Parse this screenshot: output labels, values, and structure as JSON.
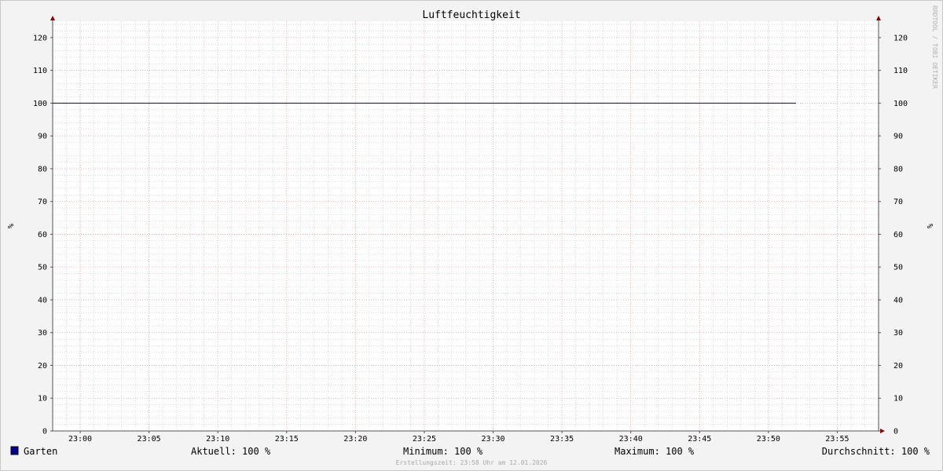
{
  "chart_data": {
    "type": "line",
    "title": "Luftfeuchtigkeit",
    "ylabel": "%",
    "ylabel_right": "%",
    "ylim": [
      0,
      125
    ],
    "y_ticks": [
      0,
      10,
      20,
      30,
      40,
      50,
      60,
      70,
      80,
      90,
      100,
      110,
      120
    ],
    "x_tick_labels": [
      "23:00",
      "23:05",
      "23:10",
      "23:15",
      "23:20",
      "23:25",
      "23:30",
      "23:35",
      "23:40",
      "23:45",
      "23:50",
      "23:55"
    ],
    "x_range": [
      "22:58",
      "23:58"
    ],
    "grid": true,
    "legend": "bottom-left",
    "series": [
      {
        "name": "Garten",
        "color": "#000099",
        "x": [
          "22:58",
          "23:52"
        ],
        "values": [
          100,
          100
        ]
      }
    ]
  },
  "watermark": "RRDTOOL / TOBI OETIKER",
  "legend": {
    "swatch_color": "#000099",
    "series_label": "Garten",
    "current": "Aktuell: 100 %",
    "minimum": "Minimum: 100 %",
    "maximum": "Maximum: 100 %",
    "average": "Durchschnitt: 100 %"
  },
  "footer": "Erstellungszeit: 23:58 Uhr am 12.01.2026",
  "colors": {
    "background": "#f3f3f3",
    "plot_background": "#ffffff",
    "major_grid": "#f0a0a0",
    "minor_grid": "#c8c8c8",
    "axis": "#555555",
    "arrow": "#8b0000",
    "line": "#000099"
  }
}
